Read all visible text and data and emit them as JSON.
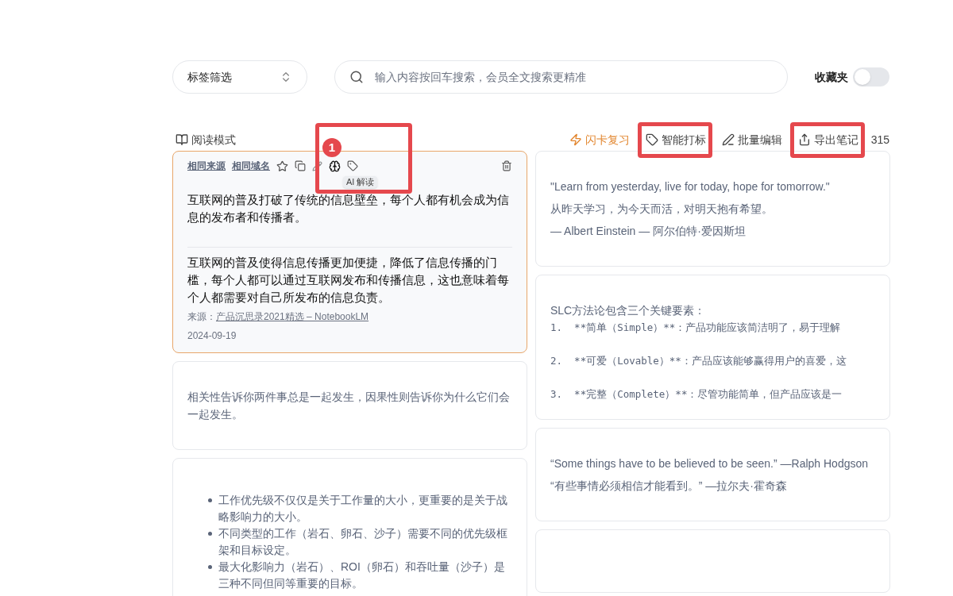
{
  "filter": {
    "label": "标签筛选"
  },
  "search": {
    "placeholder": "输入内容按回车搜索，会员全文搜索更精准"
  },
  "favorites": {
    "label": "收藏夹",
    "on": false
  },
  "reading_mode": {
    "label": "阅读模式"
  },
  "actions": [
    {
      "kind": "flash",
      "label": "闪卡复习",
      "highlighted": false
    },
    {
      "kind": "tag",
      "label": "智能打标",
      "highlighted": true
    },
    {
      "kind": "edit",
      "label": "批量编辑",
      "highlighted": false
    },
    {
      "kind": "export",
      "label": "导出笔记",
      "highlighted": true
    }
  ],
  "count": "315",
  "left_cards": [
    {
      "kind": "highlight",
      "selected": true,
      "links": [
        "相同来源",
        "相同域名"
      ],
      "tooltip": "AI 解读",
      "quote": "互联网的普及打破了传统的信息壁垒，每个人都有机会成为信息的发布者和传播者。",
      "note": "互联网的普及使得信息传播更加便捷，降低了信息传播的门槛，每个人都可以通过互联网发布和传播信息，这也意味着每个人都需要对自己所发布的信息负责。",
      "source_label": "来源：",
      "source": "产品沉思录2021精选 – NotebookLM",
      "date": "2024-09-19"
    },
    {
      "kind": "text",
      "selected": false,
      "lines": [
        "相关性告诉你两件事总是一起发生，因果性则告诉你为什么它们会一起发生。"
      ]
    },
    {
      "kind": "bullets",
      "selected": false,
      "lines": [
        "工作优先级不仅仅是关于工作量的大小，更重要的是关于战略影响力的大小。",
        "不同类型的工作（岩石、卵石、沙子）需要不同的优先级框架和目标设定。",
        "最大化影响力（岩石）、ROI（卵石）和吞吐量（沙子）是三种不同但同等重要的目标。"
      ]
    }
  ],
  "right_cards": [
    {
      "kind": "text",
      "selected": false,
      "lines": [
        "\"Learn from yesterday, live for today, hope for tomorrow.\"",
        "从昨天学习，为今天而活，对明天抱有希望。",
        "— Albert Einstein — 阿尔伯特·爱因斯坦"
      ]
    },
    {
      "kind": "code",
      "selected": false,
      "title": "SLC方法论包含三个关键要素：",
      "lines": [
        "1.  **简单（Simple）**：产品功能应该简洁明了，易于理解",
        "2.  **可爱（Lovable）**：产品应该能够赢得用户的喜爱，这",
        "3.  **完整（Complete）**：尽管功能简单，但产品应该是一"
      ]
    },
    {
      "kind": "text",
      "selected": false,
      "lines": [
        "“Some things have to be believed to be seen.” —Ralph Hodgson",
        "“有些事情必须相信才能看到。” —拉尔夫·霍奇森"
      ]
    },
    {
      "kind": "empty",
      "selected": false
    }
  ],
  "annotation": {
    "number": "1"
  }
}
